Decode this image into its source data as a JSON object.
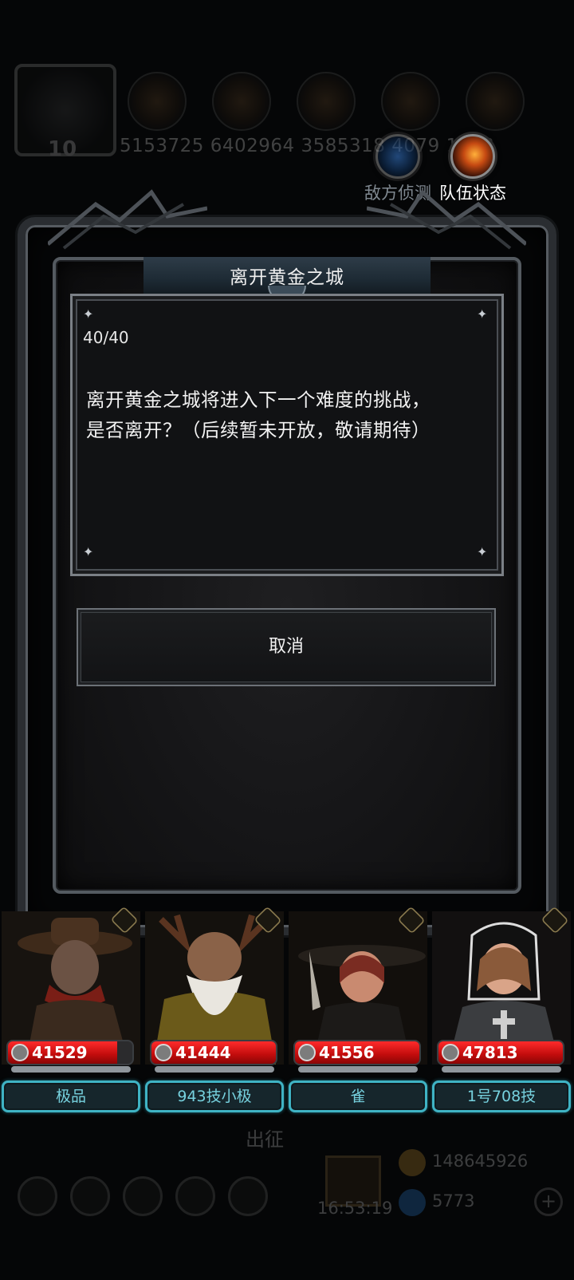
{
  "background": {
    "resource_values": "5153725 6402964 3585318 4079 1838",
    "avatar_level": "10",
    "launch_label": "出征",
    "clock": "16:53:19",
    "gold": "148645926",
    "gems": "5773"
  },
  "top_actions": {
    "enemy_scan": "敌方侦测",
    "team_status": "队伍状态"
  },
  "dialog": {
    "title": "离开黄金之城",
    "counter": "40/40",
    "message_line1": "离开黄金之城将进入下一个难度的挑战，",
    "message_line2": "是否离开？（后续暂未开放，敬请期待）",
    "cancel_label": "取消"
  },
  "heroes": [
    {
      "hp": "41529",
      "hp_fill": 0.88,
      "name": "极品"
    },
    {
      "hp": "41444",
      "hp_fill": 1.0,
      "name": "943技小极"
    },
    {
      "hp": "41556",
      "hp_fill": 1.0,
      "name": "雀"
    },
    {
      "hp": "47813",
      "hp_fill": 1.0,
      "name": "1号708技"
    }
  ],
  "colors": {
    "hp_red": "#d01010",
    "name_border": "#3fb3c4",
    "frame_metal": "#565b61"
  }
}
